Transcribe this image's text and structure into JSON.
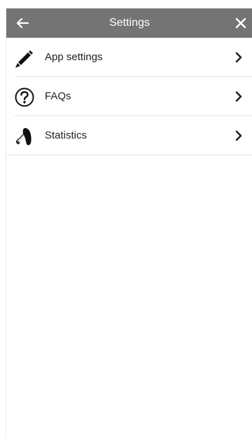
{
  "header": {
    "title": "Settings",
    "back_icon": "back-arrow-icon",
    "close_icon": "close-icon",
    "background_color": "#747474"
  },
  "items": [
    {
      "label": "App settings",
      "icon": "pencil-icon"
    },
    {
      "label": "FAQs",
      "icon": "question-circle-icon"
    },
    {
      "label": "Statistics",
      "icon": "hearing-aid-icon"
    }
  ]
}
